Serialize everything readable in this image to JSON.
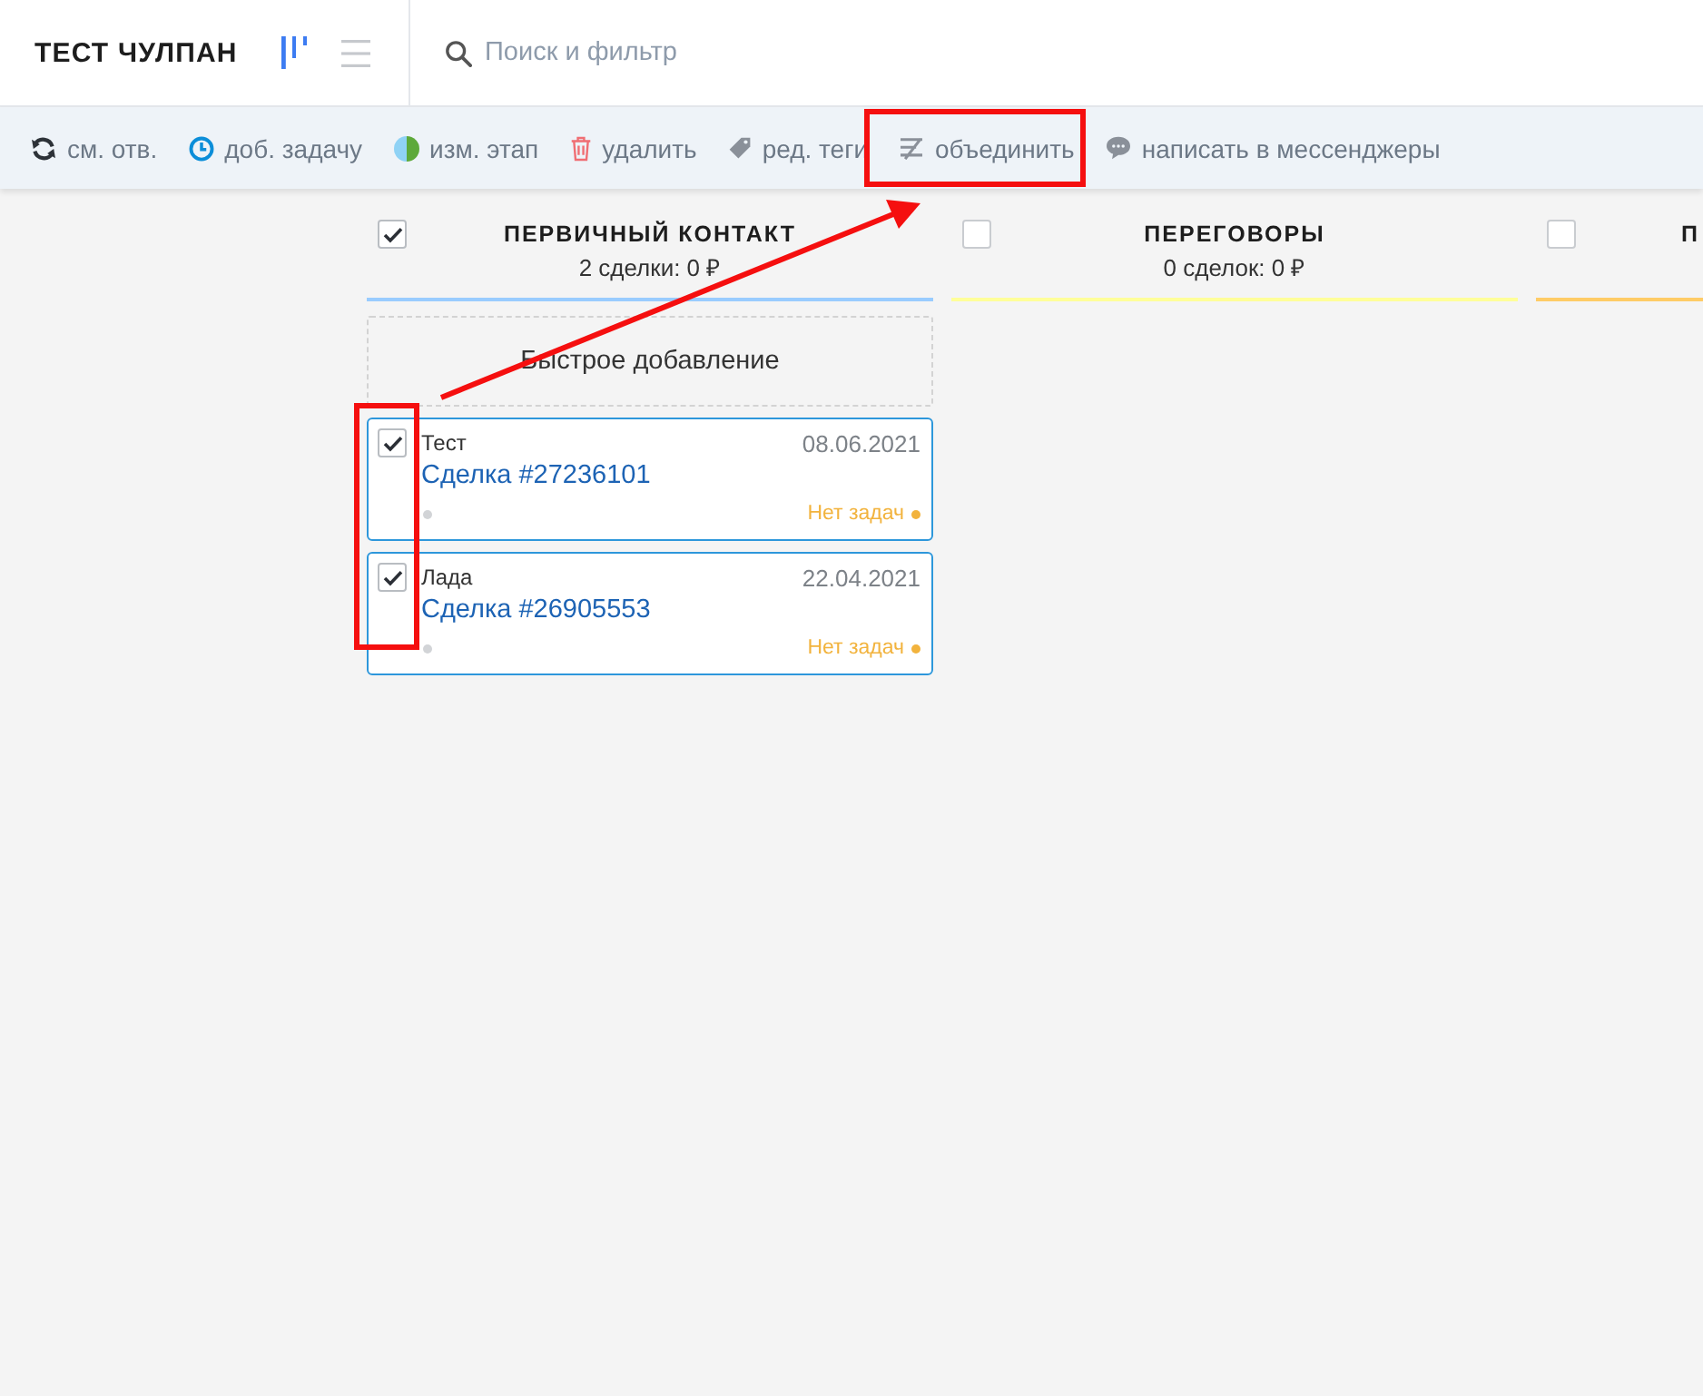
{
  "header": {
    "title": "ТЕСТ ЧУЛПАН",
    "views": [
      {
        "kind": "pipeline",
        "selected": true
      },
      {
        "kind": "list",
        "selected": false
      }
    ],
    "search": {
      "placeholder": "Поиск и фильтр"
    }
  },
  "toolbar": [
    {
      "kind": "reassign",
      "label": "см. отв."
    },
    {
      "kind": "task",
      "label": "доб. задачу"
    },
    {
      "kind": "stage",
      "label": "изм. этап"
    },
    {
      "kind": "delete",
      "label": "удалить"
    },
    {
      "kind": "tags",
      "label": "ред. теги"
    },
    {
      "kind": "merge",
      "label": "объединить"
    },
    {
      "kind": "messenger",
      "label": "написать в мессенджеры"
    }
  ],
  "columns": [
    {
      "title": "ПЕРВИЧНЫЙ КОНТАКТ",
      "summary": "2 сделки: 0 ₽",
      "checked": true,
      "color": "#99ccff",
      "quick_add": "Быстрое добавление",
      "cards": [
        {
          "name": "Тест",
          "date": "08.06.2021",
          "title": "Сделка #27236101",
          "tasks": "Нет задач",
          "checked": true
        },
        {
          "name": "Лада",
          "date": "22.04.2021",
          "title": "Сделка #26905553",
          "tasks": "Нет задач",
          "checked": true
        }
      ]
    },
    {
      "title": "ПЕРЕГОВОРЫ",
      "summary": "0 сделок: 0 ₽",
      "checked": false,
      "color": "#ffff99"
    },
    {
      "title": "П",
      "checked": false,
      "color": "#ffcc66"
    }
  ]
}
